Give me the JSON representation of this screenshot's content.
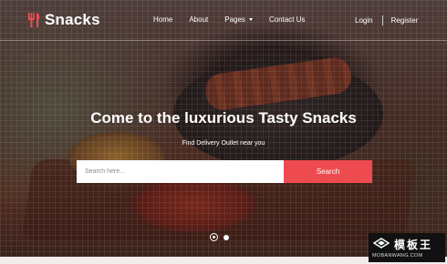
{
  "brand": {
    "name": "Snacks",
    "accent_color": "#ee4b50",
    "icon": "fork-knife-icon"
  },
  "nav": {
    "items": [
      "Home",
      "About",
      "Pages",
      "Contact Us"
    ],
    "pages_dropdown_icon": "caret-down-icon",
    "login": "Login",
    "register": "Register"
  },
  "hero": {
    "headline_prefix": "Come to the luxurious",
    "headline_emphasis": "Tasty Snacks",
    "subheadline": "Find Delivery Outlet near you",
    "search": {
      "placeholder": "Search here...",
      "button_label": "Search"
    },
    "slides": {
      "count": 2,
      "active": 1
    }
  },
  "watermark": {
    "title": "模板王",
    "url": "MOBANWANG.COM",
    "icon": "watermark-logo-icon"
  }
}
